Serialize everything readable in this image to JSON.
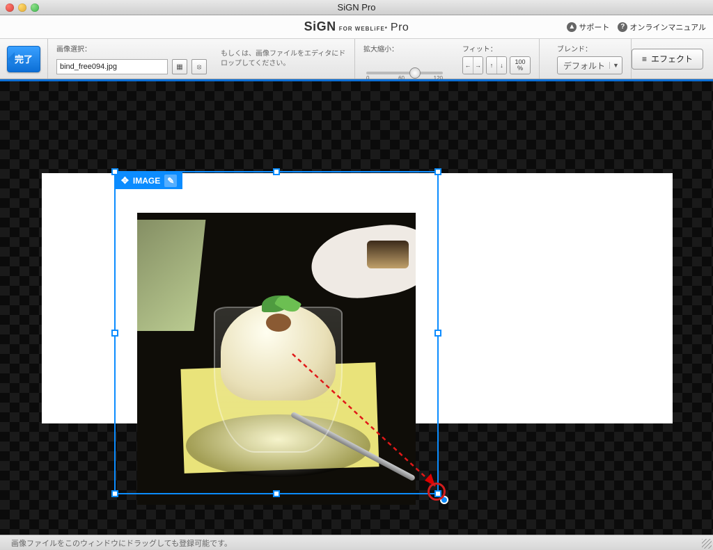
{
  "window": {
    "title": "SiGN Pro"
  },
  "brand": {
    "name": "SiGN",
    "tagline": "FOR WEBLiFE*",
    "suffix": "Pro",
    "support_label": "サポート",
    "manual_label": "オンラインマニュアル"
  },
  "toolbar": {
    "done_label": "完了",
    "image_select_label": "画像選択：",
    "filename": "bind_free094.jpg",
    "drop_hint": "もしくは、画像ファイルをエディタにドロップしてください。",
    "zoom_label": "拡大縮小：",
    "zoom_min": "0",
    "zoom_mid": "60",
    "zoom_max": "120",
    "fit_label": "フィット：",
    "pct_value": "100",
    "pct_unit": "%",
    "blend_label": "ブレンド：",
    "blend_value": "デフォルト",
    "effect_label": "エフェクト"
  },
  "canvas": {
    "image_tag": "IMAGE"
  },
  "status": {
    "text": "画像ファイルをこのウィンドウにドラッグしても登録可能です。"
  }
}
